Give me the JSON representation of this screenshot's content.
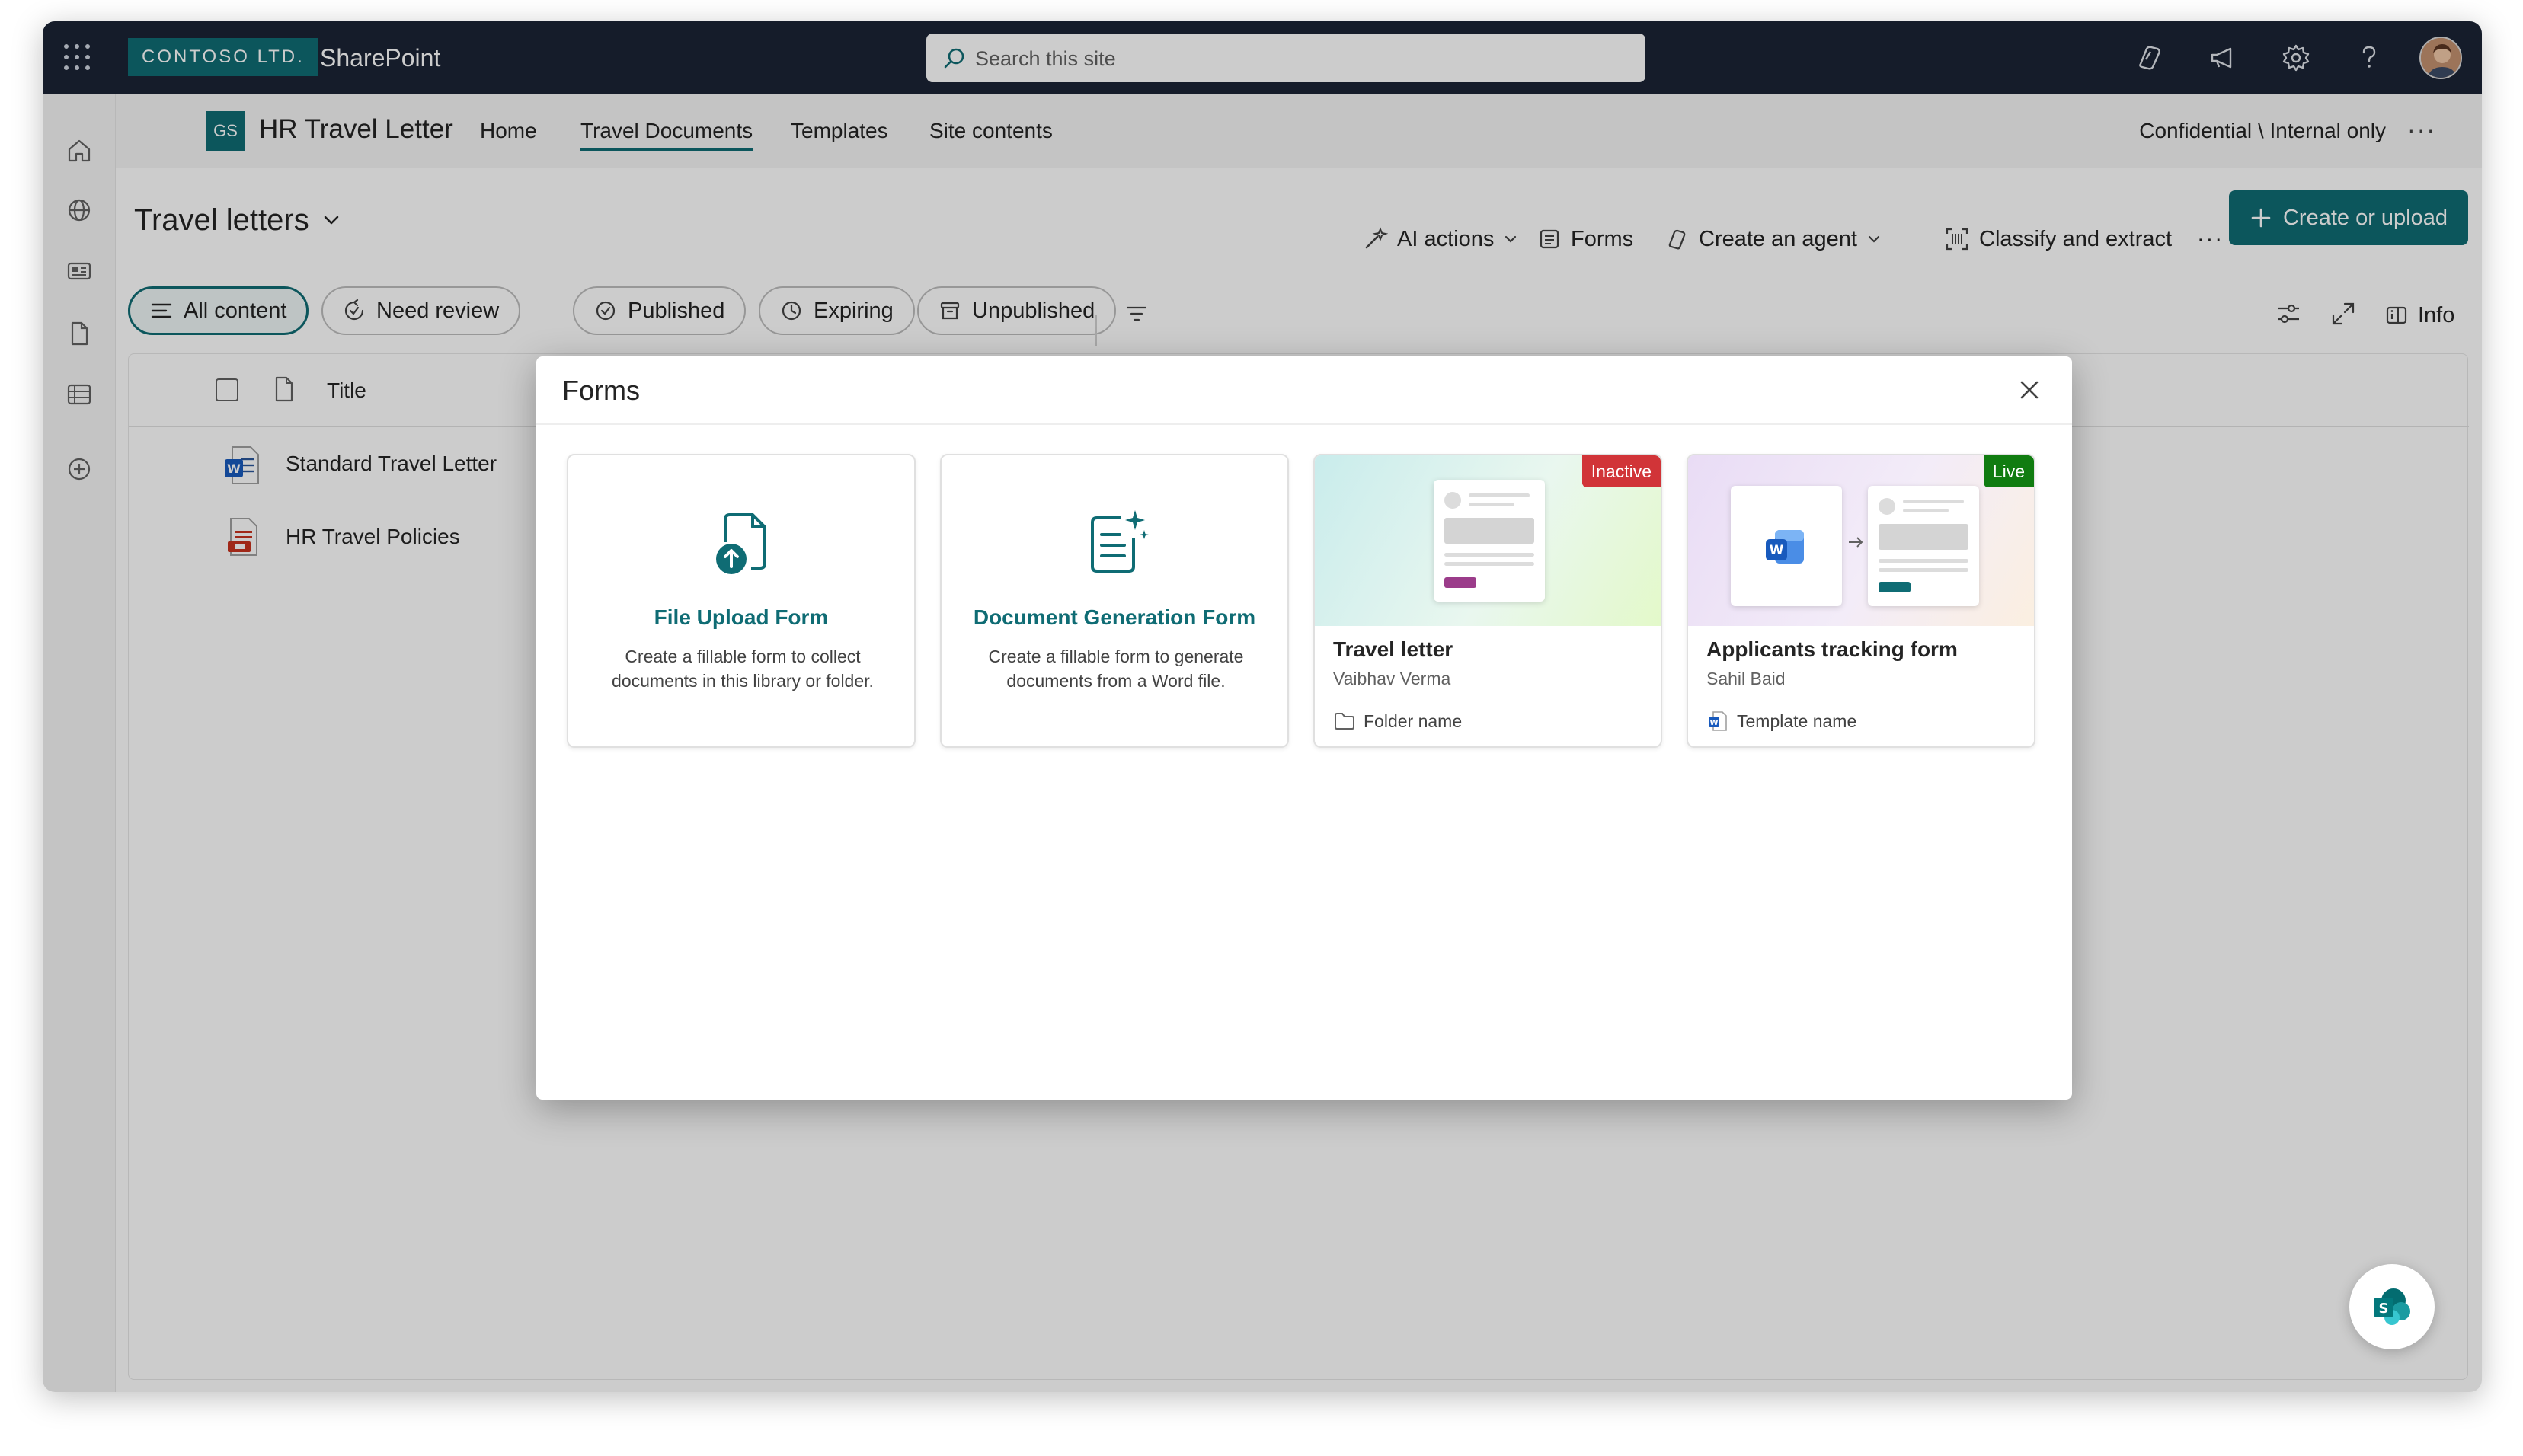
{
  "topbar": {
    "org": "CONTOSO LTD.",
    "app": "SharePoint",
    "search_placeholder": "Search this site",
    "icons": [
      "copilot-icon",
      "megaphone-icon",
      "gear-icon",
      "help-icon"
    ]
  },
  "site": {
    "logo": "GS",
    "title": "HR Travel Letter",
    "nav": [
      "Home",
      "Travel Documents",
      "Templates",
      "Site contents"
    ],
    "active_nav": "Travel Documents",
    "sensitivity": "Confidential \\ Internal only",
    "more": "···"
  },
  "library": {
    "title": "Travel letters",
    "commands": {
      "ai_actions": "AI actions",
      "forms": "Forms",
      "create_agent": "Create an agent",
      "classify": "Classify and extract",
      "more": "···",
      "create_upload": "Create or upload"
    },
    "filters": [
      "All content",
      "Need review",
      "Published",
      "Expiring",
      "Unpublished"
    ],
    "info": "Info",
    "columns": {
      "title": "Title"
    },
    "rows": [
      {
        "name": "Standard Travel Letter",
        "type": "word"
      },
      {
        "name": "HR Travel Policies",
        "type": "pdf"
      }
    ]
  },
  "modal": {
    "title": "Forms",
    "cards": [
      {
        "title": "File Upload Form",
        "desc": "Create a fillable form to collect documents in this library or folder."
      },
      {
        "title": "Document Generation Form",
        "desc": "Create a fillable form to generate documents from a Word file."
      },
      {
        "title": "Travel letter",
        "author": "Vaibhav Verma",
        "meta": "Folder name",
        "status": "Inactive"
      },
      {
        "title": "Applicants tracking form",
        "author": "Sahil Baid",
        "meta": "Template name",
        "status": "Live"
      }
    ]
  },
  "colors": {
    "brand": "#0f6c74",
    "topbar": "#1b2335",
    "inactive": "#d13438",
    "live": "#107c10"
  }
}
